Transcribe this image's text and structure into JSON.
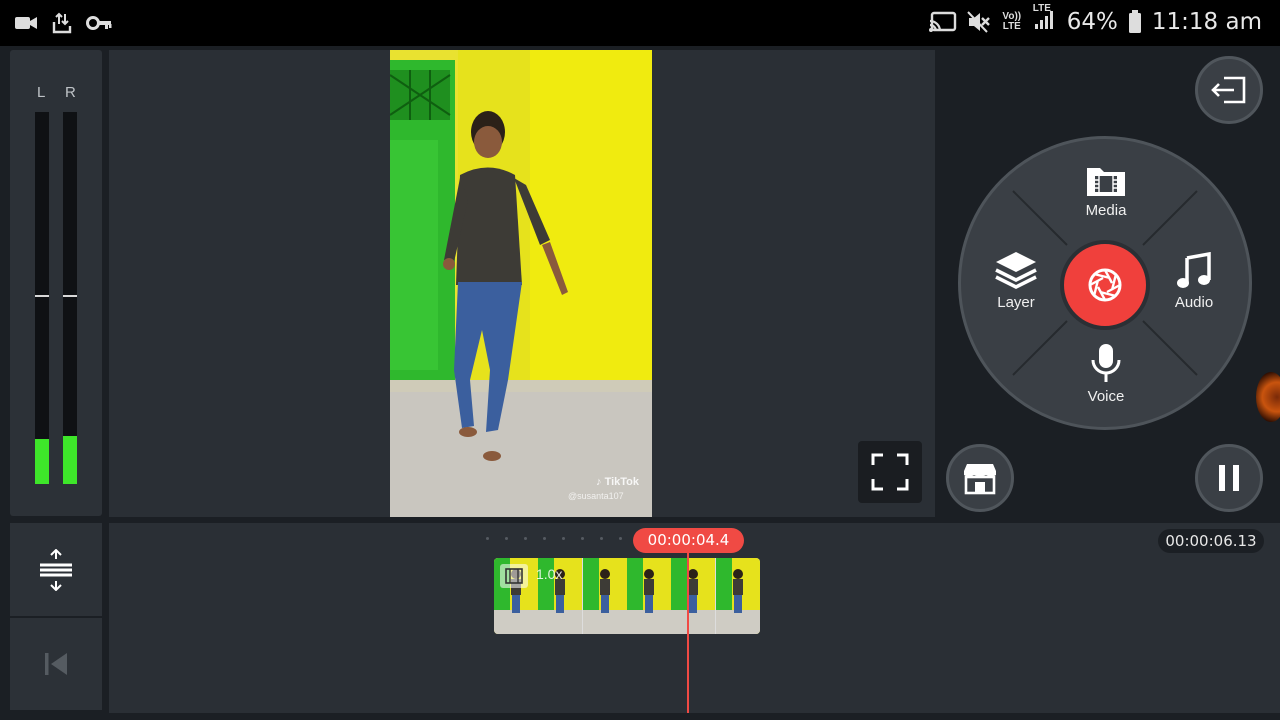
{
  "status_bar": {
    "icons_left": [
      "video-camera-icon",
      "data-transfer-icon",
      "key-icon"
    ],
    "icons_right": [
      "cast-icon",
      "mute-icon",
      "volte-icon",
      "lte-icon",
      "signal-icon",
      "battery-icon"
    ],
    "volte_label": "Vo)) LTE",
    "lte_label": "LTE",
    "battery": "64%",
    "time": "11:18 am"
  },
  "audio_meter": {
    "left_label": "L",
    "right_label": "R",
    "left_level": 0.12,
    "right_level": 0.13,
    "colors": {
      "level": "#3ee62a",
      "track": "#0f1114"
    }
  },
  "preview": {
    "watermark_brand": "TikTok",
    "watermark_user": "@susanta107"
  },
  "wheel": {
    "items": [
      {
        "label": "Media",
        "icon": "media-folder-icon"
      },
      {
        "label": "Layer",
        "icon": "layers-icon"
      },
      {
        "label": "Audio",
        "icon": "music-note-icon"
      },
      {
        "label": "Voice",
        "icon": "microphone-icon"
      }
    ],
    "record_icon": "camera-shutter-icon",
    "record_color": "#f0403c"
  },
  "right_buttons": {
    "exit_icon": "exit-icon",
    "store_icon": "store-icon",
    "pause_icon": "pause-icon"
  },
  "timeline": {
    "current_time": "00:00:04.4",
    "total_time": "00:00:06.13",
    "clip_speed": "1.0x",
    "playhead_color": "#f04a44"
  },
  "side_tools": {
    "top_icon": "timeline-adjust-icon",
    "bottom_icon": "skip-to-start-icon"
  }
}
